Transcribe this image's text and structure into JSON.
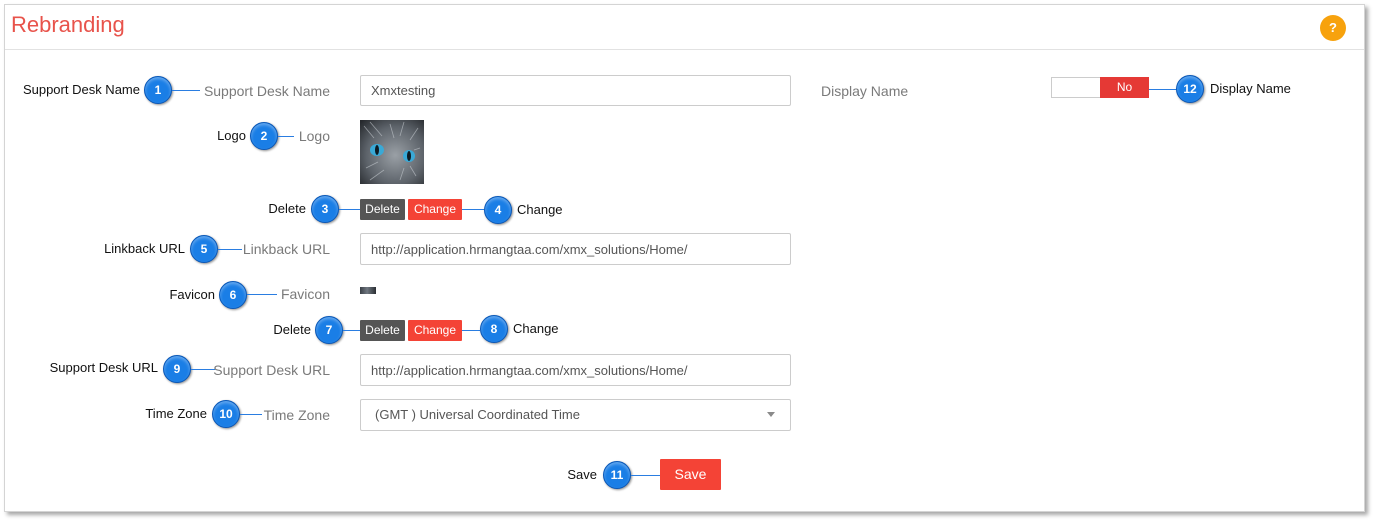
{
  "page": {
    "title": "Rebranding",
    "help_label": "?"
  },
  "form": {
    "support_desk_name": {
      "label": "Support Desk Name",
      "value": "Xmxtesting"
    },
    "display_name": {
      "label": "Display Name",
      "toggle": "No"
    },
    "logo": {
      "label": "Logo",
      "delete_label": "Delete",
      "change_label": "Change"
    },
    "linkback_url": {
      "label": "Linkback URL",
      "value": "http://application.hrmangtaa.com/xmx_solutions/Home/"
    },
    "favicon": {
      "label": "Favicon",
      "delete_label": "Delete",
      "change_label": "Change"
    },
    "support_desk_url": {
      "label": "Support Desk URL",
      "value": "http://application.hrmangtaa.com/xmx_solutions/Home/"
    },
    "time_zone": {
      "label": "Time Zone",
      "value": "(GMT ) Universal Coordinated Time"
    },
    "save_label": "Save"
  },
  "callouts": [
    {
      "number": "1",
      "text": "Support Desk Name"
    },
    {
      "number": "2",
      "text": "Logo"
    },
    {
      "number": "3",
      "text": "Delete"
    },
    {
      "number": "4",
      "text": "Change"
    },
    {
      "number": "5",
      "text": "Linkback URL"
    },
    {
      "number": "6",
      "text": "Favicon"
    },
    {
      "number": "7",
      "text": "Delete"
    },
    {
      "number": "8",
      "text": "Change"
    },
    {
      "number": "9",
      "text": "Support Desk URL"
    },
    {
      "number": "10",
      "text": "Time Zone"
    },
    {
      "number": "11",
      "text": "Save"
    },
    {
      "number": "12",
      "text": "Display Name"
    }
  ],
  "icons": {
    "help": "question-circle-icon",
    "time_zone_dropdown": "caret-down-icon"
  },
  "colors": {
    "title": "#e8534b",
    "help": "#f7a20d",
    "primary_button": "#f44336",
    "secondary_button": "#555555",
    "toggle_off": "#e53935",
    "callout": "#1a7ee6"
  }
}
